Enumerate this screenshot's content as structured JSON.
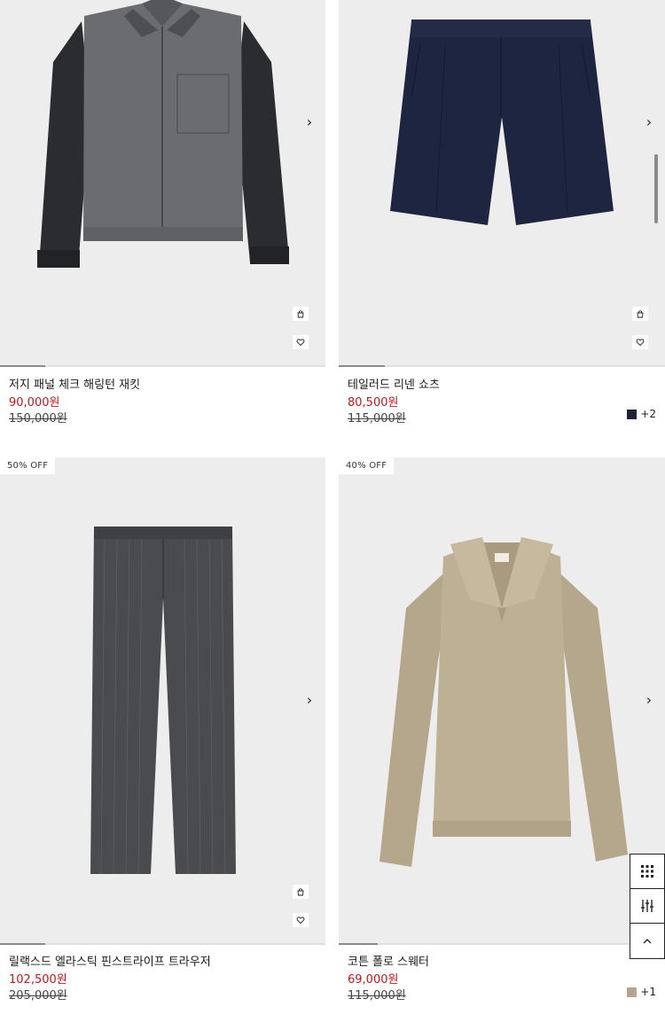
{
  "products": [
    {
      "name": "저지 패널 체크 해링턴 재킷",
      "sale_price": "90,000원",
      "original_price": "150,000원",
      "badge": "",
      "image_progress": 0.14
    },
    {
      "name": "테일러드 리넨 쇼츠",
      "sale_price": "80,500원",
      "original_price": "115,000원",
      "badge": "",
      "image_progress": 0.14,
      "swatch_color": "#1e2233",
      "more_colors": "+2"
    },
    {
      "name": "릴랙스드 엘라스틱 핀스트라이프 트라우저",
      "sale_price": "102,500원",
      "original_price": "205,000원",
      "badge": "50% OFF",
      "image_progress": 0.14
    },
    {
      "name": "코튼 폴로 스웨터",
      "sale_price": "69,000원",
      "original_price": "115,000원",
      "badge": "40% OFF",
      "image_progress": 0.12,
      "swatch_color": "#b3a68c",
      "more_colors": "+1"
    }
  ],
  "icons": {
    "next": "chevron-right-icon",
    "cart": "shopping-bag-icon",
    "wishlist": "heart-icon",
    "grid": "grid-view-icon",
    "filter": "filter-sliders-icon",
    "top": "chevron-up-icon"
  },
  "colors": {
    "sale": "#c4161c",
    "image_bg": "#ededed"
  }
}
